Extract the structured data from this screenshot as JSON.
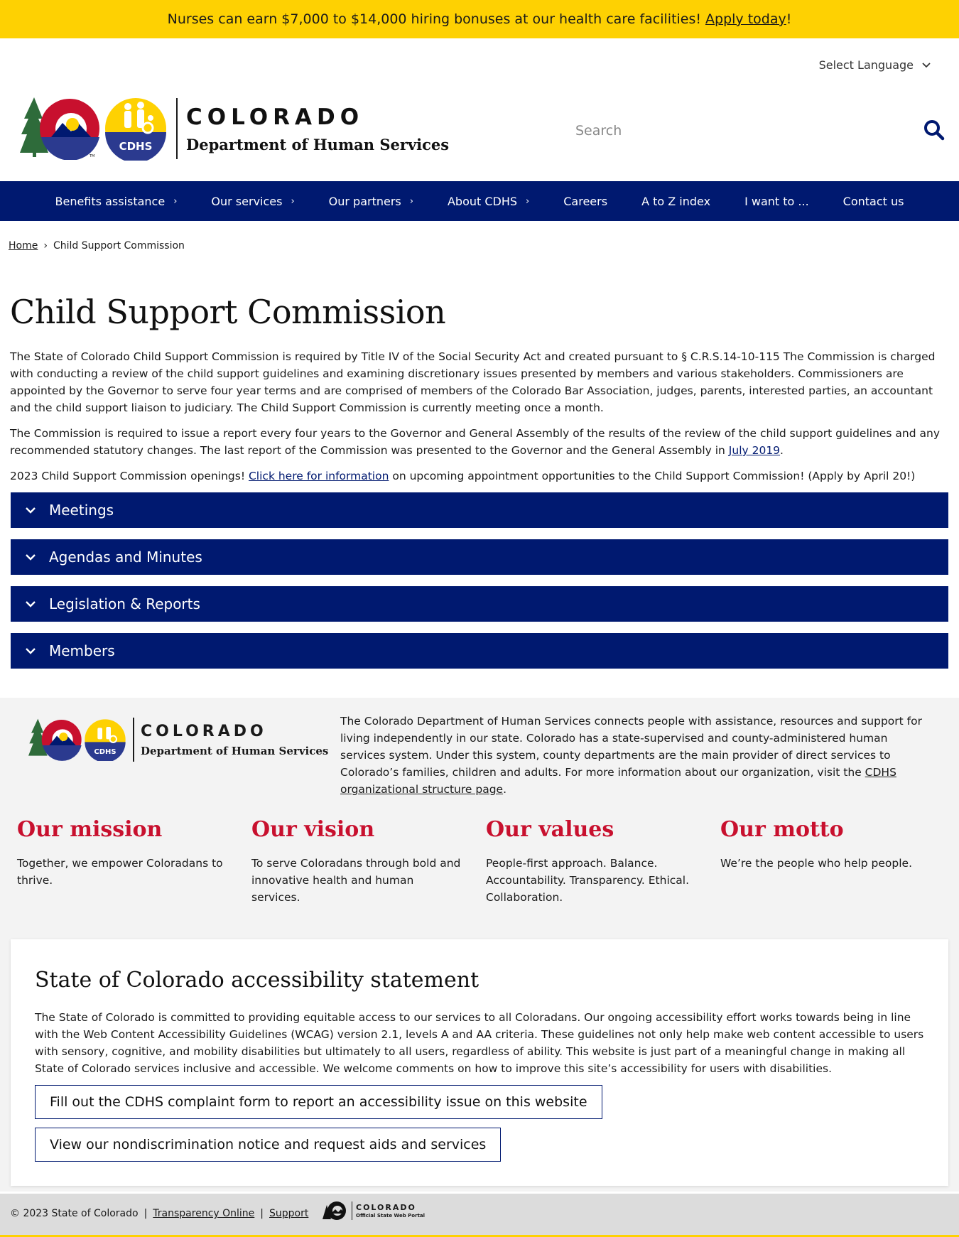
{
  "alert": {
    "text": "Nurses can earn $7,000 to $14,000 hiring bonuses at our health care facilities!",
    "link": "Apply today",
    "suffix": "!"
  },
  "language": {
    "label": "Select Language"
  },
  "brand": {
    "line1": "COLORADO",
    "line2": "Department of Human Services",
    "badge": "CDHS"
  },
  "search": {
    "placeholder": "Search"
  },
  "nav": {
    "items": [
      {
        "label": "Benefits assistance"
      },
      {
        "label": "Our services"
      },
      {
        "label": "Our partners"
      },
      {
        "label": "About CDHS"
      },
      {
        "label": "Careers"
      },
      {
        "label": "A to Z index"
      },
      {
        "label": "I want to ..."
      },
      {
        "label": "Contact us"
      }
    ]
  },
  "breadcrumb": {
    "home": "Home",
    "separator": "›",
    "current": "Child Support Commission"
  },
  "page": {
    "title": "Child Support Commission",
    "p1": "The State of Colorado Child Support Commission is required by Title IV of the Social Security Act and created pursuant to § C.R.S.14-10-115 The Commission is charged with conducting a review of the child support guidelines and examining discretionary issues presented by members and various stakeholders. Commissioners are appointed by the Governor to serve four year terms and are comprised of members of the Colorado Bar Association, judges, parents, interested parties, an accountant and the child support liaison to judiciary. The Child Support Commission is currently meeting once a month.",
    "p2_before": "The Commission is required to issue a report every four years to the Governor and General Assembly of the results of the review of the child support guidelines and any recommended statutory changes. The last report of the Commission was presented to the Governor and the General Assembly in",
    "p2_link": "July 2019",
    "p2_after": ".",
    "p3_before": "2023 Child Support Commission openings!",
    "p3_link": "Click here for information",
    "p3_after": "on upcoming appointment opportunities to the Child Support Commission! (Apply by April 20!)"
  },
  "accordions": [
    {
      "label": "Meetings"
    },
    {
      "label": "Agendas and Minutes"
    },
    {
      "label": "Legislation & Reports"
    },
    {
      "label": "Members"
    }
  ],
  "footer": {
    "about_before": "The Colorado Department of Human Services connects people with assistance, resources and support for living independently in our state. Colorado has a state-supervised and county-administered human services system. Under this system, county departments are the main provider of direct services to Colorado’s families, children and adults. For more information about our organization, visit the",
    "about_link": "CDHS organizational structure page",
    "about_after": ".",
    "values": [
      {
        "title": "Our mission",
        "text": "Together, we empower Coloradans to thrive."
      },
      {
        "title": "Our vision",
        "text": "To serve Coloradans through bold and innovative health and human services."
      },
      {
        "title": "Our values",
        "text": "People-first approach. Balance. Accountability. Transparency. Ethical. Collaboration."
      },
      {
        "title": "Our motto",
        "text": "We’re the people who help people."
      }
    ],
    "a11y": {
      "title": "State of Colorado accessibility statement",
      "text": "The State of Colorado is committed to providing equitable access to our services to all Coloradans. Our ongoing accessibility effort works towards being in line with the Web Content Accessibility Guidelines (WCAG) version 2.1, levels A and AA criteria. These guidelines not only help make web content accessible to users with sensory, cognitive, and mobility disabilities but ultimately to all users, regardless of ability. This website is just part of a meaningful change in making all State of Colorado services inclusive and accessible. We welcome comments on how to improve this site’s accessibility for users with disabilities.",
      "button1": "Fill out the CDHS complaint form to report an accessibility issue on this website",
      "button2": "View our nondiscrimination notice and request aids and services"
    },
    "copyright": "© 2023 State of Colorado",
    "sep": "|",
    "link1": "Transparency Online",
    "link2": "Support",
    "portal_line1": "COLORADO",
    "portal_line2": "Official State Web Portal"
  },
  "colors": {
    "navy": "#001970",
    "yellow": "#fed102",
    "red": "#c8102e",
    "green": "#2e6b3a"
  }
}
